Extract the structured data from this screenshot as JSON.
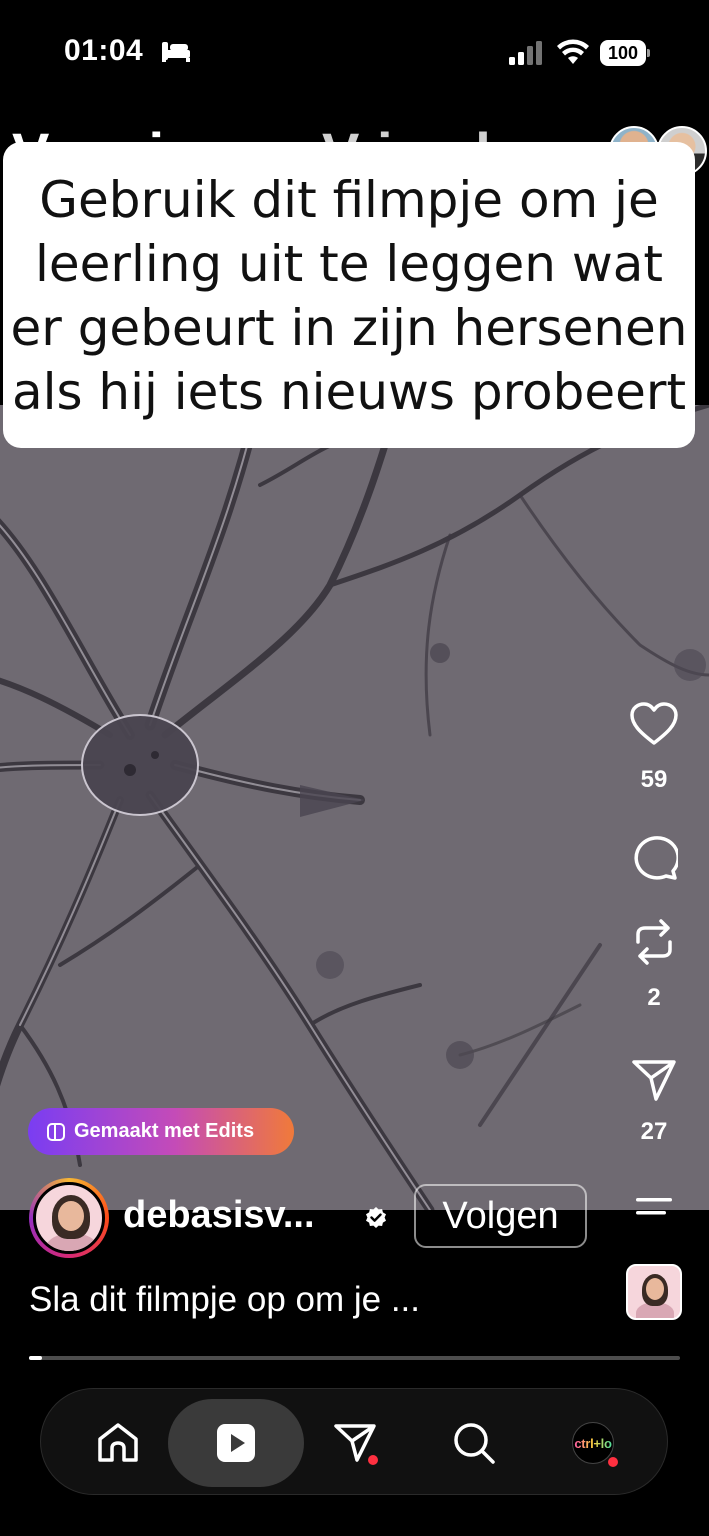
{
  "status_bar": {
    "time": "01:04",
    "battery": "100"
  },
  "feed_tabs": {
    "for_you": "Voor jou",
    "friends": "Vrienden"
  },
  "caption": "Gebruik dit filmpje om je\nleerling uit te leggen wat\ner gebeurt in zijn hersenen\nals hij iets nieuws probeert",
  "actions": {
    "likes": "59",
    "reposts": "2",
    "shares": "27"
  },
  "edits_badge": "Gemaakt met Edits",
  "author": {
    "username": "debasisv...",
    "verified": true,
    "follow_label": "Volgen"
  },
  "description": "Sla dit filmpje op om je ...",
  "progress": {
    "fraction": 0.02
  },
  "bottom_nav": {
    "items": [
      "home-icon",
      "reels-icon",
      "direct-icon",
      "search-icon",
      "profile"
    ],
    "active": "reels-icon",
    "profile_label": "ctrl+lo"
  },
  "colors": {
    "video_bg": "#6f6a72",
    "badge_start": "#7a3df2",
    "badge_end": "#f07a3a",
    "notification": "#ff3040"
  }
}
